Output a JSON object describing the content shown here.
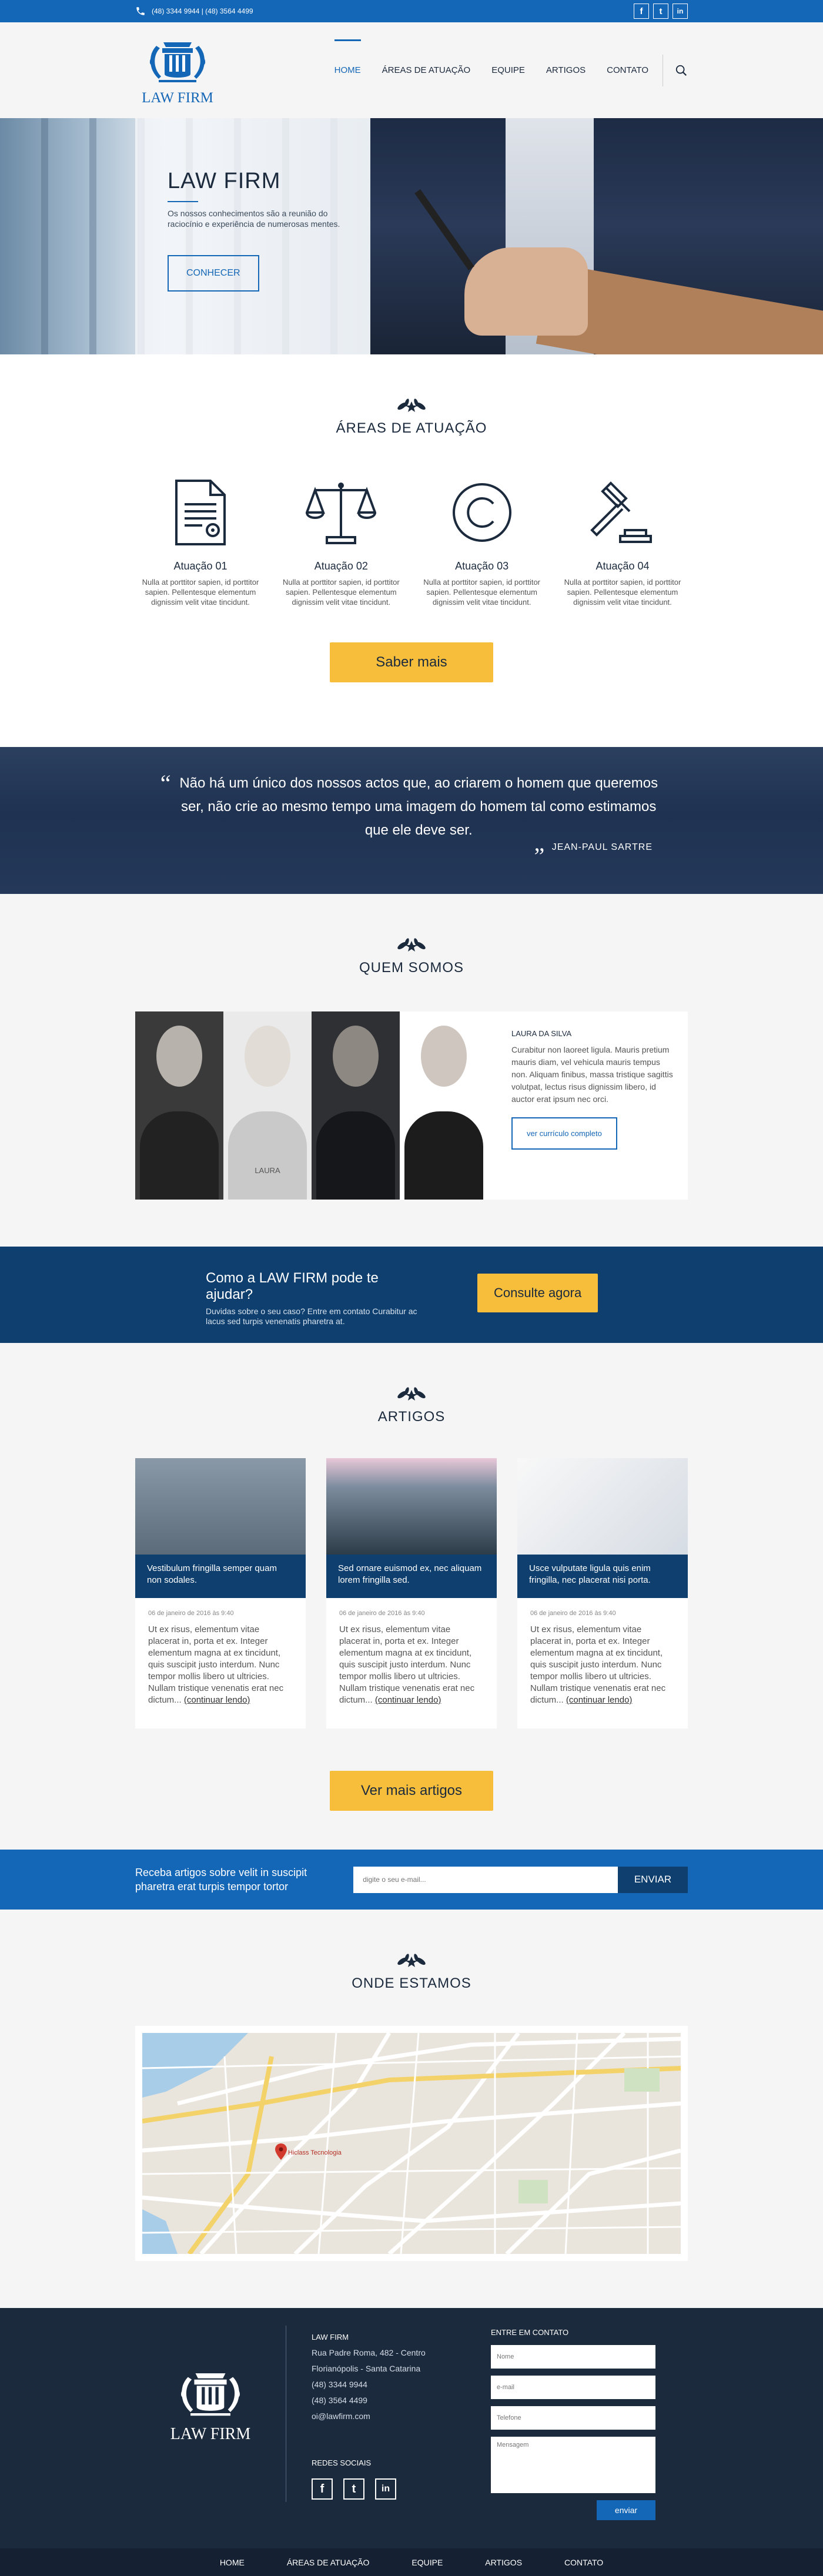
{
  "topbar": {
    "phones": "(48) 3344 9944  |  (48) 3564 4499",
    "social_icons": [
      "facebook-icon",
      "twitter-icon",
      "linkedin-icon"
    ],
    "social_glyphs": [
      "f",
      "t",
      "in"
    ]
  },
  "header": {
    "logo_text": "LAW FIRM",
    "nav": [
      {
        "label": "HOME",
        "active": true
      },
      {
        "label": "ÁREAS DE ATUAÇÃO"
      },
      {
        "label": "EQUIPE"
      },
      {
        "label": "ARTIGOS"
      },
      {
        "label": "CONTATO"
      }
    ],
    "search_icon": "search-icon"
  },
  "hero": {
    "title": "LAW FIRM",
    "text": "Os nossos conhecimentos são a reunião do raciocínio e experiência de numerosas mentes.",
    "button": "CONHECER"
  },
  "areas": {
    "title": "ÁREAS DE ATUAÇÃO",
    "items": [
      {
        "icon": "document-icon",
        "title": "Atuação 01",
        "text": "Nulla at porttitor sapien, id porttitor sapien. Pellentesque elementum dignissim velit vitae tincidunt."
      },
      {
        "icon": "scales-icon",
        "title": "Atuação 02",
        "text": "Nulla at porttitor sapien, id porttitor sapien. Pellentesque elementum dignissim velit vitae tincidunt."
      },
      {
        "icon": "copyright-icon",
        "title": "Atuação 03",
        "text": "Nulla at porttitor sapien, id porttitor sapien. Pellentesque elementum dignissim velit vitae tincidunt."
      },
      {
        "icon": "gavel-icon",
        "title": "Atuação 04",
        "text": "Nulla at porttitor sapien, id porttitor sapien. Pellentesque elementum dignissim velit vitae tincidunt."
      }
    ],
    "button": "Saber mais"
  },
  "quote": {
    "text": "Não há um único dos nossos actos que, ao criarem o homem que queremos ser, não crie ao mesmo tempo uma imagem do homem tal como estimamos que ele deve ser.",
    "author": "JEAN-PAUL SARTRE"
  },
  "quem": {
    "title": "QUEM SOMOS",
    "hover_label": "LAURA",
    "name": "LAURA DA SILVA",
    "bio": "Curabitur non laoreet ligula. Mauris pretium mauris diam, vel vehicula mauris tempus non. Aliquam finibus, massa tristique sagittis volutpat, lectus risus dignissim libero, id auctor erat ipsum nec orci.",
    "button": "ver currículo completo"
  },
  "cta": {
    "title": "Como a LAW FIRM pode te ajudar?",
    "text": "Duvidas sobre o seu caso? Entre em contato Curabitur ac lacus sed turpis venenatis pharetra at.",
    "button": "Consulte agora"
  },
  "artigos": {
    "title": "ARTIGOS",
    "cards": [
      {
        "caption": "Vestibulum fringilla semper quam non sodales.",
        "date": "06 de janeiro de 2016 às 9:40",
        "text": "Ut ex risus, elementum vitae placerat in, porta et ex. Integer elementum magna at ex tincidunt, quis suscipit justo interdum. Nunc tempor mollis libero ut ultricies. Nullam tristique venenatis erat nec dictum...",
        "more": "(continuar lendo)"
      },
      {
        "caption": "Sed ornare euismod ex, nec aliquam lorem fringilla sed.",
        "date": "06 de janeiro de 2016 às 9:40",
        "text": "Ut ex risus, elementum vitae placerat in, porta et ex. Integer elementum magna at ex tincidunt, quis suscipit justo interdum. Nunc tempor mollis libero ut ultricies. Nullam tristique venenatis erat nec dictum...",
        "more": "(continuar lendo)"
      },
      {
        "caption": "Usce vulputate ligula quis enim fringilla, nec placerat nisi porta.",
        "date": "06 de janeiro de 2016 às 9:40",
        "text": "Ut ex risus, elementum vitae placerat in, porta et ex. Integer elementum magna at ex tincidunt, quis suscipit justo interdum. Nunc tempor mollis libero ut ultricies. Nullam tristique venenatis erat nec dictum...",
        "more": "(continuar lendo)"
      }
    ],
    "button": "Ver mais artigos"
  },
  "newsletter": {
    "text": "Receba artigos sobre velit in suscipit pharetra erat turpis tempor tortor",
    "placeholder": "digite o seu e-mail...",
    "button": "ENVIAR"
  },
  "onde": {
    "title": "ONDE ESTAMOS",
    "marker_label": "Hiclass Tecnologia"
  },
  "footer": {
    "logo_text": "LAW FIRM",
    "address_title": "LAW FIRM",
    "address_lines": [
      "Rua Padre Roma, 482 - Centro",
      "Florianópolis - Santa Catarina",
      "(48) 3344 9944",
      "(48) 3564 4499",
      "oi@lawfirm.com"
    ],
    "social_title": "REDES SOCIAIS",
    "form_title": "ENTRE EM CONTATO",
    "form_placeholders": [
      "Nome",
      "e-mail",
      "Telefone",
      "Mensagem"
    ],
    "form_button": "enviar"
  },
  "bottom_nav": [
    "HOME",
    "ÁREAS DE ATUAÇÃO",
    "EQUIPE",
    "ARTIGOS",
    "CONTATO"
  ],
  "colors": {
    "primary": "#1466b6",
    "navy": "#1c2a3d",
    "accent": "#f6be3b",
    "dark_blue": "#0e3f6f"
  }
}
